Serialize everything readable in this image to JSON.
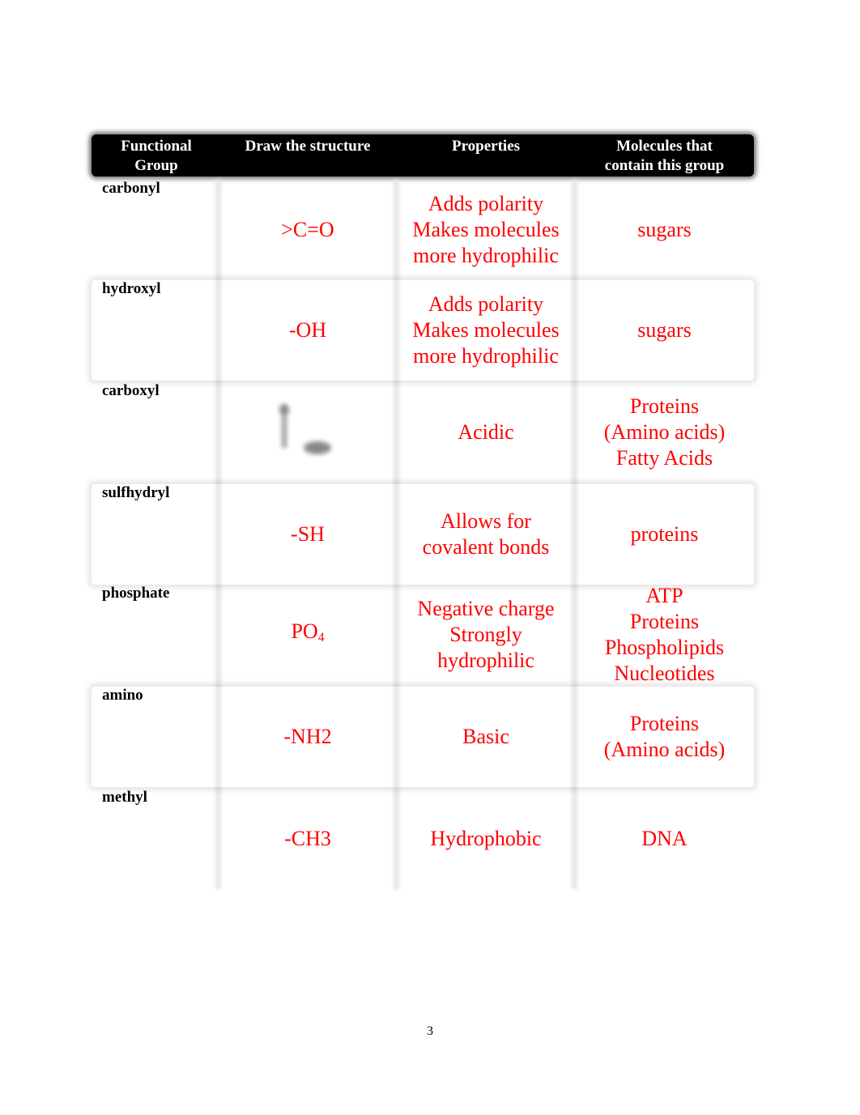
{
  "table": {
    "headers": [
      [
        "Functional",
        "Group"
      ],
      [
        "Draw the structure"
      ],
      [
        "Properties"
      ],
      [
        "Molecules that",
        "contain this group"
      ]
    ],
    "rows": [
      {
        "group": "carbonyl",
        "structure": ">C=O",
        "properties": [
          "Adds polarity",
          "Makes molecules",
          "more hydrophilic"
        ],
        "molecules": [
          "sugars"
        ]
      },
      {
        "group": "hydroxyl",
        "structure": "-OH",
        "properties": [
          "Adds polarity",
          "Makes molecules",
          "more hydrophilic"
        ],
        "molecules": [
          "sugars"
        ]
      },
      {
        "group": "carboxyl",
        "structure": "",
        "structure_icon": "carboxyl-structure-image",
        "properties": [
          "Acidic"
        ],
        "molecules": [
          "Proteins",
          "(Amino acids)",
          "Fatty Acids"
        ]
      },
      {
        "group": "sulfhydryl",
        "structure": "-SH",
        "properties": [
          "Allows for",
          "covalent bonds"
        ],
        "molecules": [
          "proteins"
        ]
      },
      {
        "group": "phosphate",
        "structure": "PO",
        "structure_subscript": "4",
        "properties": [
          "Negative charge",
          "Strongly",
          "hydrophilic"
        ],
        "molecules": [
          "ATP",
          "Proteins",
          "Phospholipids",
          "Nucleotides"
        ]
      },
      {
        "group": "amino",
        "structure": "-NH2",
        "properties": [
          "Basic"
        ],
        "molecules": [
          "Proteins",
          "(Amino acids)"
        ]
      },
      {
        "group": "methyl",
        "structure": "-CH3",
        "properties": [
          "Hydrophobic"
        ],
        "molecules": [
          "DNA"
        ]
      }
    ]
  },
  "colors": {
    "answer": "#ff0000",
    "header_bg": "#000000",
    "header_text": "#ffffff"
  },
  "page_number": "3"
}
